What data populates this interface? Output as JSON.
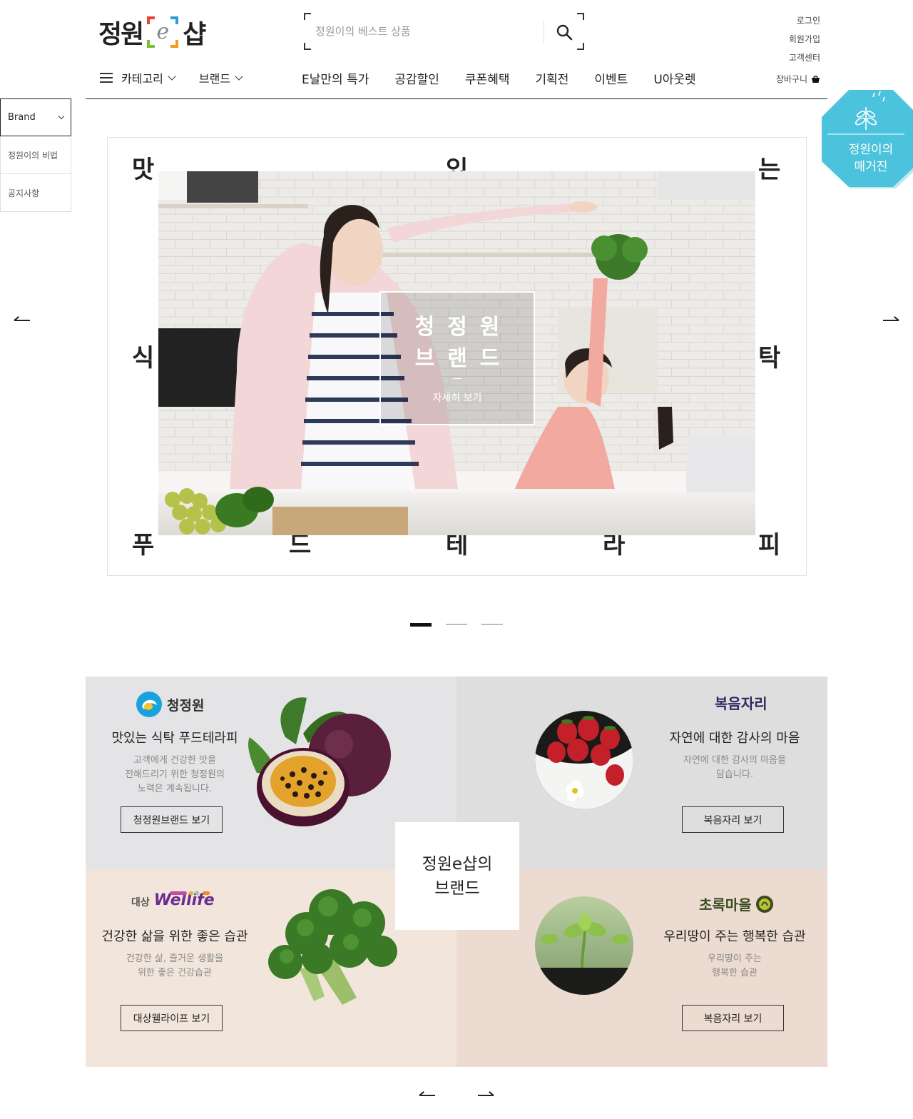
{
  "header": {
    "logo_left": "정원",
    "logo_e": "e",
    "logo_right": "샵",
    "search_placeholder": "정원이의 베스트 상품",
    "util": {
      "login": "로그인",
      "join": "회원가입",
      "support": "고객센터",
      "cart": "장바구니"
    }
  },
  "gnb": {
    "category": "카테고리",
    "brand": "브랜드",
    "items": [
      "E날만의 특가",
      "공감할인",
      "쿠폰혜택",
      "기획전",
      "이벤트",
      "U아웃렛"
    ]
  },
  "side_menu": {
    "selected": "Brand",
    "items": [
      "정원이의 비법",
      "공지사항"
    ]
  },
  "magazine": {
    "line1": "정원이의",
    "line2": "매거진"
  },
  "hero": {
    "chars": [
      "맛",
      "있",
      "는",
      "식",
      "탁",
      "푸",
      "드",
      "테",
      "라",
      "피"
    ],
    "overlay_line1": "청정원",
    "overlay_line2": "브랜드",
    "more": "자세히 보기",
    "slide_count": 3,
    "active_slide": 1
  },
  "brands": {
    "center_line1": "정원e샵의",
    "center_line2": "브랜드",
    "cards": [
      {
        "logo": "청정원",
        "title": "맛있는 식탁 푸드테라피",
        "desc": "고객에게 건강한 맛을\n전해드리기 위한 청정원의\n노력은 계속됩니다.",
        "cta": "청정원브랜드 보기"
      },
      {
        "logo": "복음자리",
        "title": "자연에 대한 감사의 마음",
        "desc": "자연에 대한 감사의 마음을\n담습니다.",
        "cta": "복음자리 보기"
      },
      {
        "logo_prefix": "대상",
        "logo": "Wellife",
        "title": "건강한 삶을 위한 좋은 습관",
        "desc": "건강한 삶, 즐거운 생활을\n위한 좋은 건강습관",
        "cta": "대상웰라이프 보기"
      },
      {
        "logo": "초록마을",
        "title": "우리땅이 주는 행복한 습관",
        "desc": "우리땅이 주는\n행복한 습관",
        "cta": "복음자리 보기"
      }
    ]
  },
  "colors": {
    "accent_teal": "#4cc3dc",
    "chungjungone_blue": "#1aa2dc",
    "wellife_purple": "#6b2c8f"
  }
}
